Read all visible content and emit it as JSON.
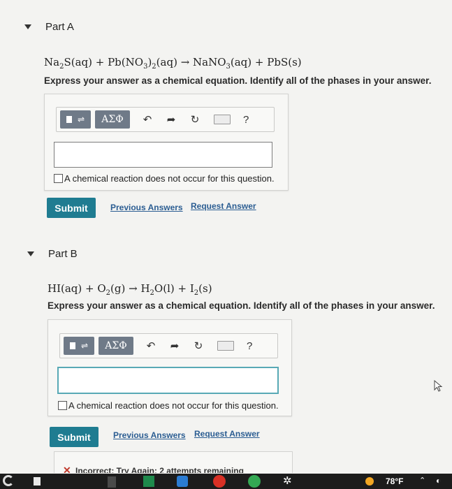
{
  "partA": {
    "title": "Part A",
    "equation_parts": [
      "Na",
      "2",
      "S(aq) + Pb(NO",
      "3",
      ")",
      "2",
      "(aq) → NaNO",
      "3",
      "(aq) + PbS(s)"
    ],
    "instruction": "Express your answer as a chemical equation. Identify all of the phases in your answer.",
    "toolbar": {
      "greek_label": "ΑΣΦ",
      "help_label": "?"
    },
    "answer_value": "",
    "no_reaction_label": "A chemical reaction does not occur for this question.",
    "submit_label": "Submit",
    "previous_answers_label": "Previous Answers",
    "request_answer_label": "Request Answer"
  },
  "partB": {
    "title": "Part B",
    "equation_parts": [
      "HI(aq) + O",
      "2",
      "(g) → H",
      "2",
      "O(l) + I",
      "2",
      "(s)"
    ],
    "instruction": "Express your answer as a chemical equation. Identify all of the phases in your answer.",
    "toolbar": {
      "greek_label": "ΑΣΦ",
      "help_label": "?"
    },
    "answer_value": "",
    "no_reaction_label": "A chemical reaction does not occur for this question.",
    "submit_label": "Submit",
    "previous_answers_label": "Previous Answers",
    "request_answer_label": "Request Answer",
    "feedback": "Incorrect; Try Again; 2 attempts remaining"
  },
  "taskbar": {
    "temperature": "78°F",
    "colors": {
      "accent": "#1f7c91",
      "link": "#2b5d92",
      "input_focus": "#58a9b5"
    }
  }
}
